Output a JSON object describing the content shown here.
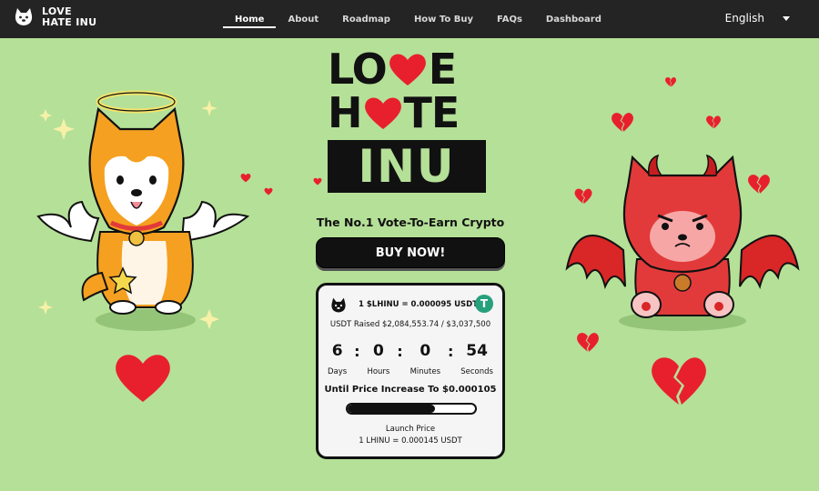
{
  "nav": {
    "brand": "LOVE HATE INU",
    "links": [
      "Home",
      "About",
      "Roadmap",
      "How To Buy",
      "FAQs",
      "Dashboard"
    ],
    "active": "Home",
    "language": "English"
  },
  "logo": {
    "line1": "LO E",
    "line2": "H TE",
    "line3": "INU",
    "line1_a": "LO",
    "line1_b": "E",
    "line2_a": "H",
    "line2_b": "TE"
  },
  "hero": {
    "tagline": "The No.1 Vote-To-Earn Crypto",
    "buy_label": "BUY NOW!"
  },
  "presale": {
    "price": "1 $LHINU = 0.000095 USDT",
    "raised": "USDT Raised $2,084,553.74 / $3,037,500",
    "progress": 0.686,
    "countdown": {
      "days": "6",
      "hours": "0",
      "minutes": "0",
      "seconds": "54",
      "days_label": "Days",
      "hours_label": "Hours",
      "minutes_label": "Minutes",
      "seconds_label": "Seconds"
    },
    "until": "Until Price Increase To $0.000105",
    "launch_label": "Launch Price",
    "launch_price": "1 LHINU = 0.000145 USDT",
    "token_icon": "T"
  },
  "colors": {
    "background": "#b5e098",
    "nav": "#242424",
    "heart": "#e8202e",
    "dog_orange": "#f5a020",
    "devil_red": "#e23a3a"
  },
  "icons": [
    "dog-logo-icon",
    "caret-down-icon",
    "tether-icon",
    "heart-icon",
    "broken-heart-icon"
  ]
}
